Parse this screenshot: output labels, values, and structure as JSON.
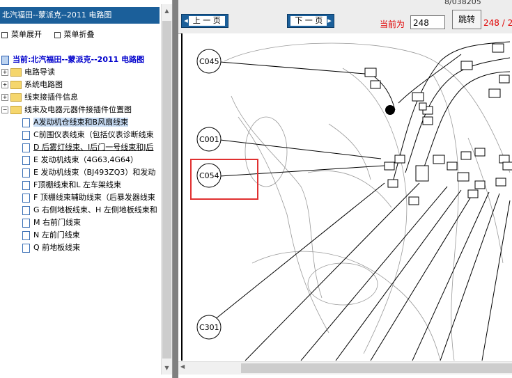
{
  "sidebar": {
    "title": "北汽福田--蒙派克--2011 电路图",
    "expand_all": "菜单展开",
    "collapse_all": "菜单折叠",
    "root_label": "当前:北汽福田--蒙派克--2011 电路图",
    "folders": [
      "电路导读",
      "系统电路图",
      "线束接插件信息",
      "线束及电器元器件接插件位置图"
    ],
    "items": [
      "A发动机仓线束和B风扇线束",
      "C前围仪表线束（包括仪表诊断线束",
      "D 后雾灯线束、I后门一号线束和J后",
      "E 发动机线束（4G63,4G64）",
      "E 发动机线束（BJ493ZQ3）和发动",
      "F顶棚线束和L 左车架线束",
      "F 顶棚线束辅助线束（后暴发器线束",
      "G 右侧地板线束、H 左侧地板线束和",
      "M 右前门线束",
      "N 左前门线束",
      "Q 前地板线束"
    ]
  },
  "toolbar": {
    "prev_label": "上 一 页",
    "next_label": "下 一 页",
    "current_label": "当前为",
    "current_page": "248",
    "jump_label": "跳转",
    "total_label": "248 / 2",
    "top_number": "8/038205"
  },
  "diagram": {
    "connectors": [
      "C045",
      "C001",
      "C054",
      "C301"
    ]
  },
  "colors": {
    "title_bg": "#1b5f9a",
    "highlight": "#e03030",
    "page_red": "#e00000"
  }
}
